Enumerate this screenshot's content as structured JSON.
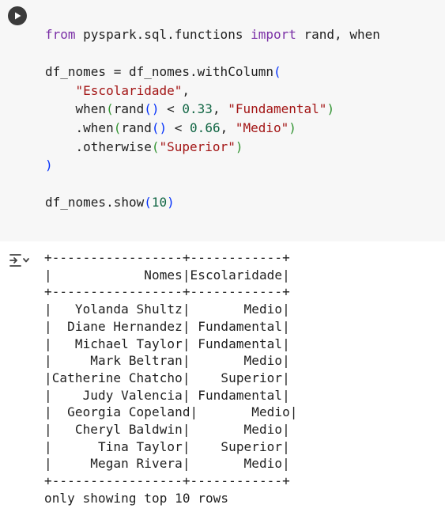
{
  "code_cell": {
    "run_button_icon": "play-icon",
    "import_line": {
      "kw_from": "from",
      "module": " pyspark.sql.functions ",
      "kw_import": "import",
      "names": " rand, when"
    },
    "assign_line": {
      "lhs": "df_nomes = df_nomes.withColumn",
      "open_paren": "("
    },
    "column_name": "\"Escolaridade\"",
    "when1": {
      "fn": "when",
      "inner": "rand",
      "op": " < ",
      "threshold": "0.33",
      "label": "\"Fundamental\""
    },
    "when2": {
      "fn": ".when",
      "inner": "rand",
      "op": " < ",
      "threshold": "0.66",
      "label": "\"Medio\""
    },
    "otherwise": {
      "fn": ".otherwise",
      "label": "\"Superior\""
    },
    "close_paren": ")",
    "show_line": {
      "call": "df_nomes.show",
      "arg": "10"
    }
  },
  "output": {
    "toggle_icon": "output-toggle-icon",
    "border": "+-----------------+------------+",
    "header_row": "|            Nomes|Escolaridade|",
    "rows": [
      "|   Yolanda Shultz|       Medio|",
      "|  Diane Hernandez| Fundamental|",
      "|   Michael Taylor| Fundamental|",
      "|     Mark Beltran|       Medio|",
      "|Catherine Chatcho|    Superior|",
      "|    Judy Valencia| Fundamental|",
      "|  Georgia Copeland|       Medio|",
      "|   Cheryl Baldwin|       Medio|",
      "|      Tina Taylor|    Superior|",
      "|     Megan Rivera|       Medio|"
    ],
    "footer": "only showing top 10 rows"
  }
}
